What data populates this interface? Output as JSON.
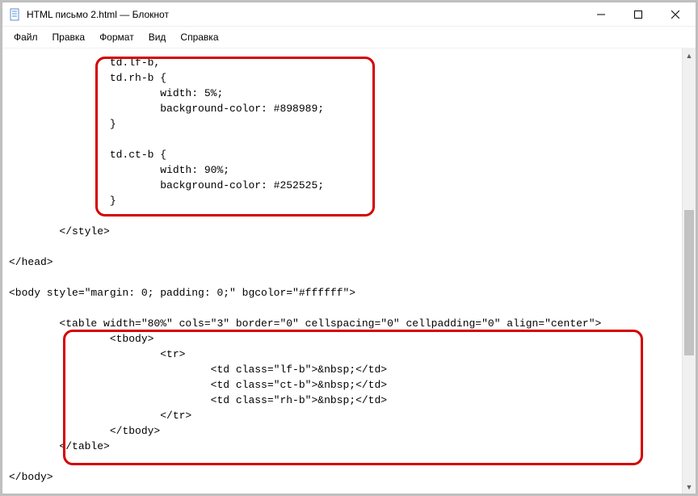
{
  "window": {
    "title": "HTML письмо 2.html — Блокнот"
  },
  "menu": {
    "file": "Файл",
    "edit": "Правка",
    "format": "Формат",
    "view": "Вид",
    "help": "Справка"
  },
  "code": {
    "l1": "                td.lf-b,",
    "l2": "                td.rh-b {",
    "l3": "                        width: 5%;",
    "l4": "                        background-color: #898989;",
    "l5": "                }",
    "l6": "",
    "l7": "                td.ct-b {",
    "l8": "                        width: 90%;",
    "l9": "                        background-color: #252525;",
    "l10": "                }",
    "l11": "",
    "l12": "        </style>",
    "l13": "",
    "l14": "</head>",
    "l15": "",
    "l16": "<body style=\"margin: 0; padding: 0;\" bgcolor=\"#ffffff\">",
    "l17": "",
    "l18": "        <table width=\"80%\" cols=\"3\" border=\"0\" cellspacing=\"0\" cellpadding=\"0\" align=\"center\">",
    "l19": "                <tbody>",
    "l20": "                        <tr>",
    "l21": "                                <td class=\"lf-b\">&nbsp;</td>",
    "l22": "                                <td class=\"ct-b\">&nbsp;</td>",
    "l23": "                                <td class=\"rh-b\">&nbsp;</td>",
    "l24": "                        </tr>",
    "l25": "                </tbody>",
    "l26": "        </table>",
    "l27": "",
    "l28": "</body>"
  }
}
